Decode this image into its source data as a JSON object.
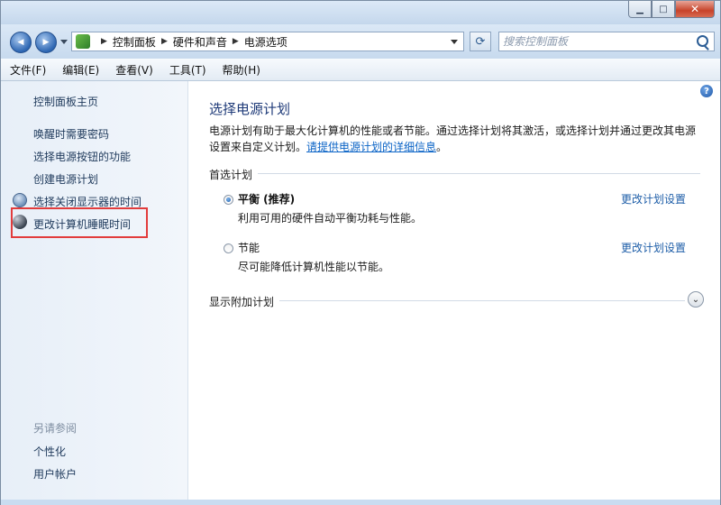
{
  "navbar": {
    "back": "◀",
    "forward": "▶",
    "breadcrumbs": [
      "控制面板",
      "硬件和声音",
      "电源选项"
    ],
    "search_placeholder": "搜索控制面板"
  },
  "menu": [
    "文件(F)",
    "编辑(E)",
    "查看(V)",
    "工具(T)",
    "帮助(H)"
  ],
  "sidebar": {
    "home": "控制面板主页",
    "links": [
      "唤醒时需要密码",
      "选择电源按钮的功能",
      "创建电源计划",
      "选择关闭显示器的时间",
      "更改计算机睡眠时间"
    ],
    "see_also_heading": "另请参阅",
    "see_also": [
      "个性化",
      "用户帐户"
    ]
  },
  "main": {
    "title": "选择电源计划",
    "desc_text": "电源计划有助于最大化计算机的性能或者节能。通过选择计划将其激活，或选择计划并通过更改其电源设置来自定义计划。",
    "desc_link": "请提供电源计划的详细信息",
    "desc_end": "。",
    "preferred_heading": "首选计划",
    "plans": [
      {
        "name": "平衡 (推荐)",
        "desc": "利用可用的硬件自动平衡功耗与性能。",
        "selected": true,
        "change": "更改计划设置"
      },
      {
        "name": "节能",
        "desc": "尽可能降低计算机性能以节能。",
        "selected": false,
        "change": "更改计划设置"
      }
    ],
    "show_more": "显示附加计划"
  },
  "colors": {
    "accent": "#1e5ea8",
    "highlight_box": "#e23c3c"
  }
}
